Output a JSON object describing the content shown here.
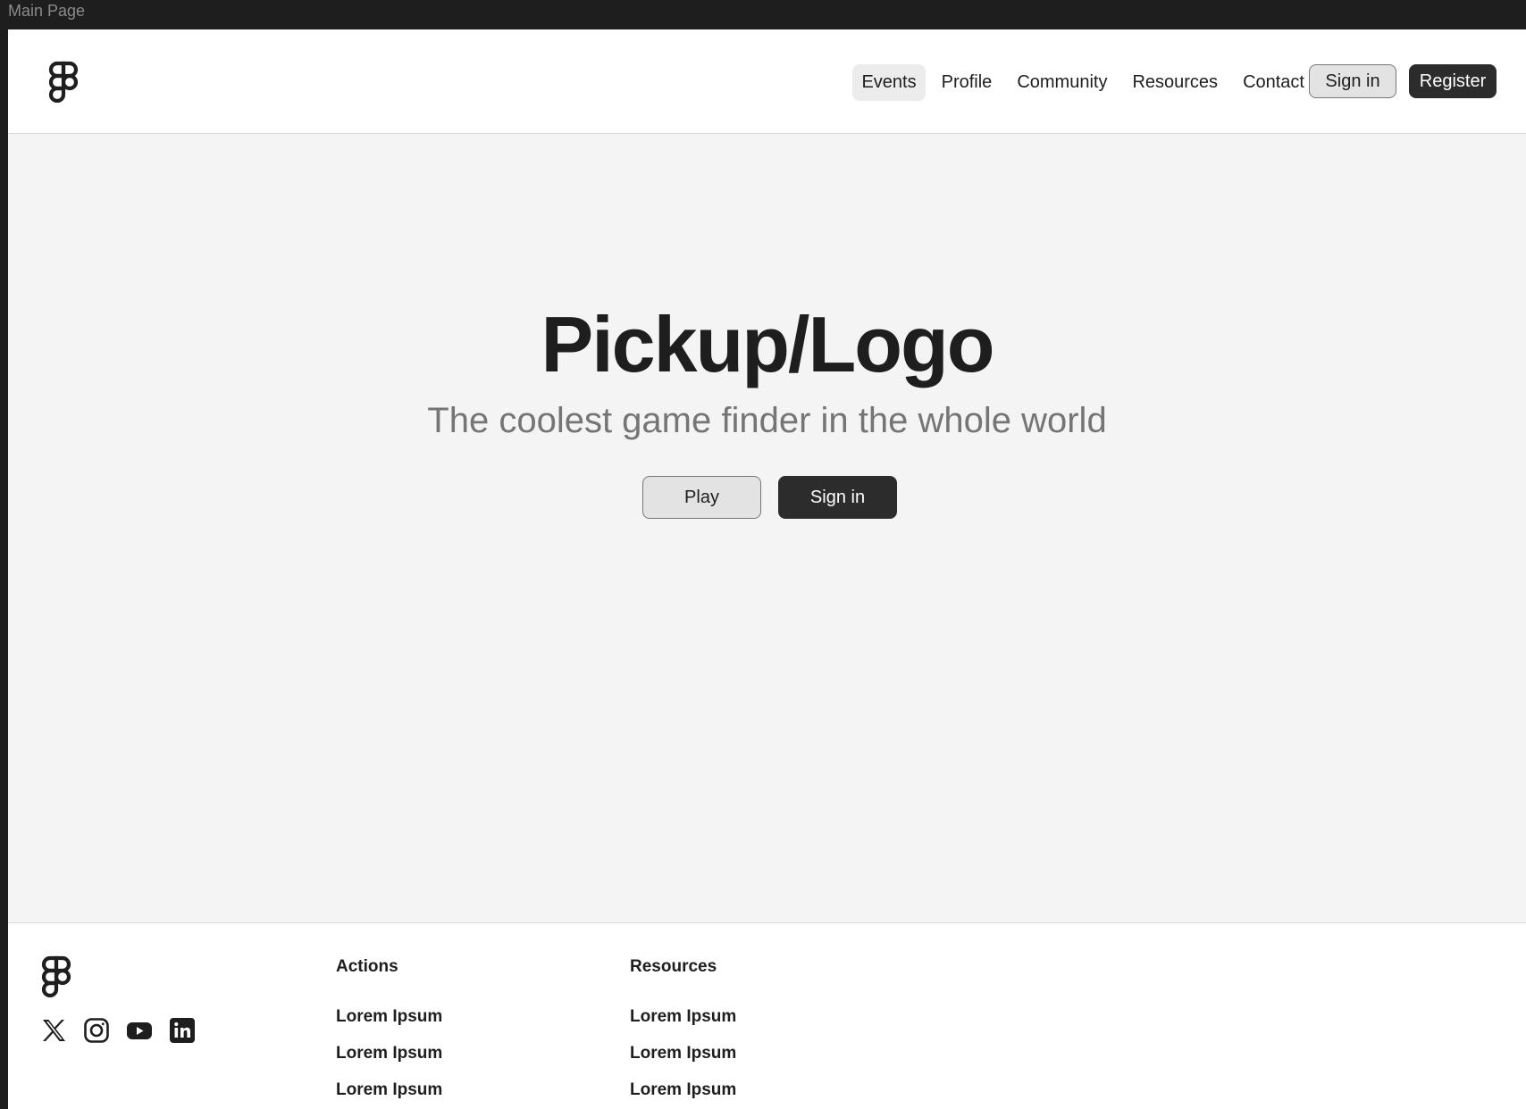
{
  "window": {
    "frame_label": "Main Page"
  },
  "header": {
    "nav": [
      "Events",
      "Profile",
      "Community",
      "Resources",
      "Contact"
    ],
    "active_nav": "Events",
    "signin_label": "Sign in",
    "register_label": "Register"
  },
  "hero": {
    "title": "Pickup/Logo",
    "subtitle": "The coolest game finder in the whole world",
    "play_label": "Play",
    "signin_label": "Sign in"
  },
  "footer": {
    "socials": [
      "x-icon",
      "instagram-icon",
      "youtube-icon",
      "linkedin-icon"
    ],
    "actions": {
      "heading": "Actions",
      "links": [
        "Lorem Ipsum",
        "Lorem Ipsum",
        "Lorem Ipsum"
      ]
    },
    "resources": {
      "heading": "Resources",
      "links": [
        "Lorem Ipsum",
        "Lorem Ipsum",
        "Lorem Ipsum"
      ]
    }
  },
  "colors": {
    "primary": "#2c2c2c",
    "secondary_bg": "#e3e3e3",
    "page_bg": "#f4f4f4",
    "subtitle": "#757575"
  }
}
